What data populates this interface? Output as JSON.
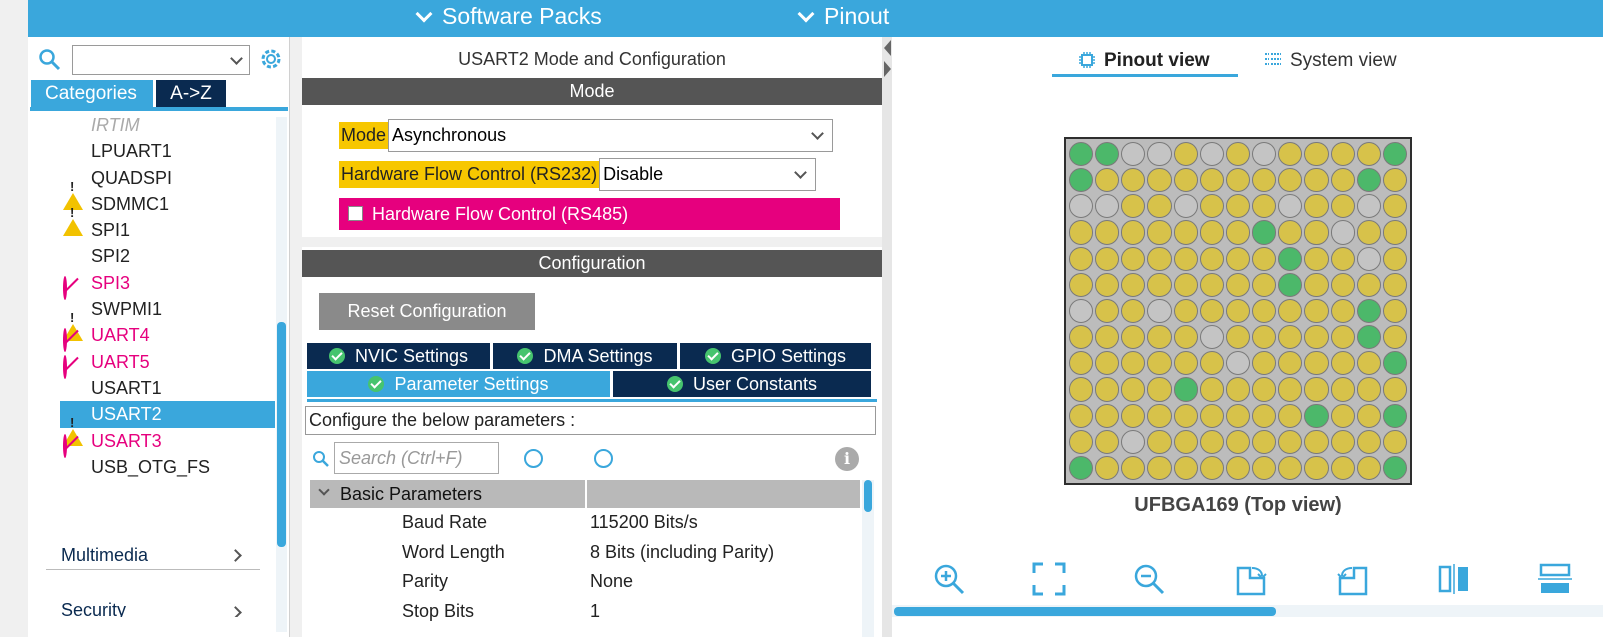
{
  "topbar": {
    "menus": [
      "Software Packs",
      "Pinout"
    ]
  },
  "left_panel": {
    "search": {
      "value": ""
    },
    "tabs": [
      "Categories",
      "A->Z"
    ],
    "peripherals": [
      {
        "label": "IRTIM",
        "status": "dim"
      },
      {
        "label": "LPUART1",
        "status": "none"
      },
      {
        "label": "QUADSPI",
        "status": "warning"
      },
      {
        "label": "SDMMC1",
        "status": "warning"
      },
      {
        "label": "SPI1",
        "status": "none"
      },
      {
        "label": "SPI2",
        "status": "none"
      },
      {
        "label": "SPI3",
        "status": "disabled"
      },
      {
        "label": "SWPMI1",
        "status": "warning"
      },
      {
        "label": "UART4",
        "status": "disabled"
      },
      {
        "label": "UART5",
        "status": "disabled"
      },
      {
        "label": "USART1",
        "status": "none"
      },
      {
        "label": "USART2",
        "status": "warning-selected"
      },
      {
        "label": "USART3",
        "status": "disabled"
      },
      {
        "label": "USB_OTG_FS",
        "status": "none"
      }
    ],
    "sections": [
      "Multimedia",
      "Security"
    ]
  },
  "mid_panel": {
    "title": "USART2 Mode and Configuration",
    "mode_band": "Mode",
    "mode_label": "Mode",
    "mode_value": "Asynchronous",
    "hfc_label": "Hardware Flow Control (RS232)",
    "hfc_value": "Disable",
    "rs485_label": "Hardware Flow Control (RS485)",
    "config_band": "Configuration",
    "reset_button": "Reset Configuration",
    "tabs_row1": [
      "NVIC Settings",
      "DMA Settings",
      "GPIO Settings"
    ],
    "tabs_row2": [
      "Parameter Settings",
      "User Constants"
    ],
    "configure_label": "Configure the below parameters :",
    "search_placeholder": "Search (Ctrl+F)",
    "group_label": "Basic Parameters",
    "params": [
      {
        "key": "Baud Rate",
        "value": "115200 Bits/s"
      },
      {
        "key": "Word Length",
        "value": "8 Bits (including Parity)"
      },
      {
        "key": "Parity",
        "value": "None"
      },
      {
        "key": "Stop Bits",
        "value": "1"
      }
    ]
  },
  "right_panel": {
    "view_tabs": [
      "Pinout view",
      "System view"
    ],
    "chip_caption": "UFBGA169 (Top view)"
  },
  "colors": {
    "accent": "#3aa7dc",
    "navy": "#0a2a50",
    "pink": "#e6007e",
    "yellow": "#f7c700",
    "green": "#46c46e"
  }
}
